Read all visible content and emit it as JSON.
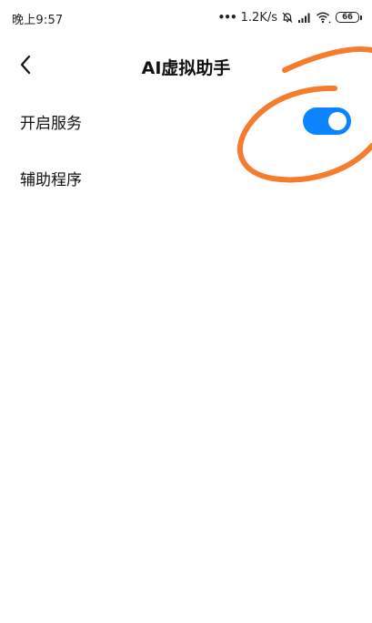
{
  "status_bar": {
    "time": "晚上9:57",
    "dots": "•••",
    "network_speed": "1.2K/s",
    "battery_level": "66",
    "icons": [
      "alarm-off-icon",
      "signal-icon",
      "wifi-icon",
      "battery-icon"
    ]
  },
  "header": {
    "back_icon": "chevron-left-icon",
    "title": "AI虚拟助手"
  },
  "settings": {
    "items": [
      {
        "label": "开启服务",
        "toggle_on": true
      },
      {
        "label": "辅助程序"
      }
    ]
  },
  "colors": {
    "toggle_on": "#0d84ff",
    "annotation_stroke": "#f57c2c",
    "background": "#ffffff"
  },
  "annotation": {
    "type": "hand-drawn-circle",
    "color": "orange"
  }
}
